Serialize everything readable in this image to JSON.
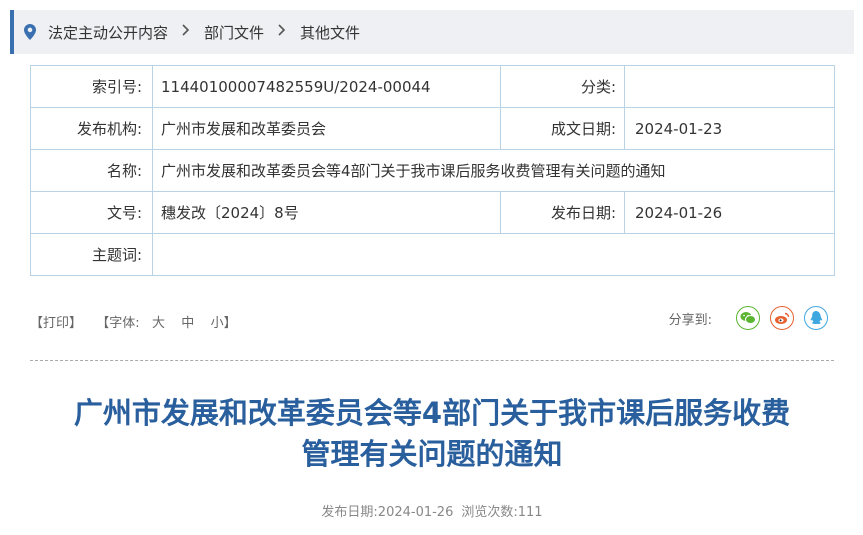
{
  "breadcrumb": {
    "items": [
      "法定主动公开内容",
      "部门文件",
      "其他文件"
    ],
    "separator": ">"
  },
  "meta": {
    "index_label": "索引号:",
    "index_value": "11440100007482559U/2024-00044",
    "category_label": "分类:",
    "category_value": "",
    "publisher_label": "发布机构:",
    "publisher_value": "广州市发展和改革委员会",
    "written_date_label": "成文日期:",
    "written_date_value": "2024-01-23",
    "name_label": "名称:",
    "name_value": "广州市发展和改革委员会等4部门关于我市课后服务收费管理有关问题的通知",
    "doc_no_label": "文号:",
    "doc_no_value": "穗发改〔2024〕8号",
    "publish_date_label": "发布日期:",
    "publish_date_value": "2024-01-26",
    "subject_label": "主题词:",
    "subject_value": ""
  },
  "toolbar": {
    "print": "【打印】",
    "font_open": "【字体:",
    "font_large": "大",
    "font_medium": "中",
    "font_small": "小】",
    "share_label": "分享到:",
    "colors": {
      "wechat": "#5cb531",
      "weibo": "#e6612f",
      "qq": "#3fa7e0"
    }
  },
  "article": {
    "title_line1": "广州市发展和改革委员会等4部门关于我市课后服务收费",
    "title_line2": "管理有关问题的通知",
    "publish_date_label": "发布日期:",
    "publish_date": "2024-01-26",
    "views_label": "浏览次数:",
    "views": "111"
  },
  "theme": {
    "accent": "#3a6fb0",
    "title_color": "#2a5f9e",
    "table_border": "#b9d3e6"
  }
}
